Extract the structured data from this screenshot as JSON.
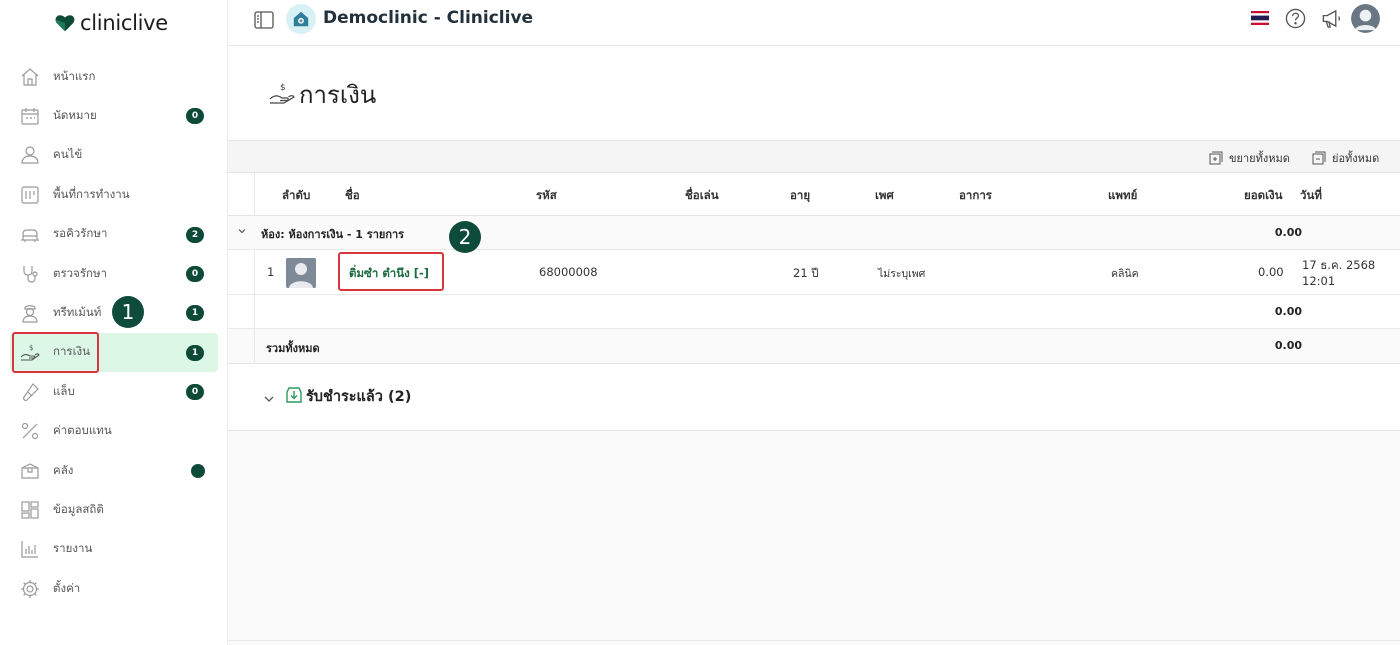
{
  "app": {
    "logo_text": "cliniclive",
    "clinic_title": "Democlinic - Cliniclive"
  },
  "sidebar": {
    "items": [
      {
        "label": "หน้าแรก",
        "icon": "home-icon",
        "badge": null
      },
      {
        "label": "นัดหมาย",
        "icon": "calendar-icon",
        "badge": "0"
      },
      {
        "label": "คนไข้",
        "icon": "user-icon",
        "badge": null
      },
      {
        "label": "พื้นที่การทำงาน",
        "icon": "workspace-icon",
        "badge": null
      },
      {
        "label": "รอคิวรักษา",
        "icon": "bed-icon",
        "badge": "2"
      },
      {
        "label": "ตรวจรักษา",
        "icon": "stethoscope-icon",
        "badge": "0"
      },
      {
        "label": "ทรีทเม้นท์",
        "icon": "nurse-icon",
        "badge": "1"
      },
      {
        "label": "การเงิน",
        "icon": "money-hand-icon",
        "badge": "1"
      },
      {
        "label": "แล็บ",
        "icon": "test-tube-icon",
        "badge": "0"
      },
      {
        "label": "ค่าตอบแทน",
        "icon": "percent-icon",
        "badge": null
      },
      {
        "label": "คลัง",
        "icon": "box-icon",
        "badge": "dot"
      },
      {
        "label": "ข้อมูลสถิติ",
        "icon": "dashboard-icon",
        "badge": null
      },
      {
        "label": "รายงาน",
        "icon": "bar-chart-icon",
        "badge": null
      },
      {
        "label": "ตั้งค่า",
        "icon": "gear-icon",
        "badge": null
      }
    ],
    "active_index": 7
  },
  "steps": {
    "one": "1",
    "two": "2"
  },
  "page": {
    "title": "การเงิน"
  },
  "toolbar": {
    "expand_all": "ขยายทั้งหมด",
    "collapse_all": "ย่อทั้งหมด"
  },
  "table": {
    "headers": {
      "order": "ลำดับ",
      "name": "ชื่อ",
      "code": "รหัส",
      "nickname": "ชื่อเล่น",
      "age": "อายุ",
      "sex": "เพศ",
      "symptom": "อาการ",
      "doctor": "แพทย์",
      "amount": "ยอดเงิน",
      "date": "วันที่"
    },
    "group": {
      "label": "ห้อง: ห้องการเงิน - 1 รายการ",
      "total": "0.00"
    },
    "row": {
      "order": "1",
      "name": "ติ่มซำ ตำนึง [-]",
      "code": "68000008",
      "age": "21 ปี",
      "sex": "ไม่ระบุเพศ",
      "doctor": "คลินิค",
      "amount": "0.00",
      "date_line1": "17 ธ.ค. 2568",
      "date_line2": "12:01"
    },
    "subtotal": "0.00",
    "grand_total_label": "รวมทั้งหมด",
    "grand_total": "0.00"
  },
  "paid": {
    "label": "รับชำระแล้ว (2)"
  },
  "colors": {
    "brand_dark": "#0d4a38",
    "active_bg": "#dcf7e6",
    "highlight_red": "#d9363e",
    "link_green": "#1a6b3e"
  }
}
